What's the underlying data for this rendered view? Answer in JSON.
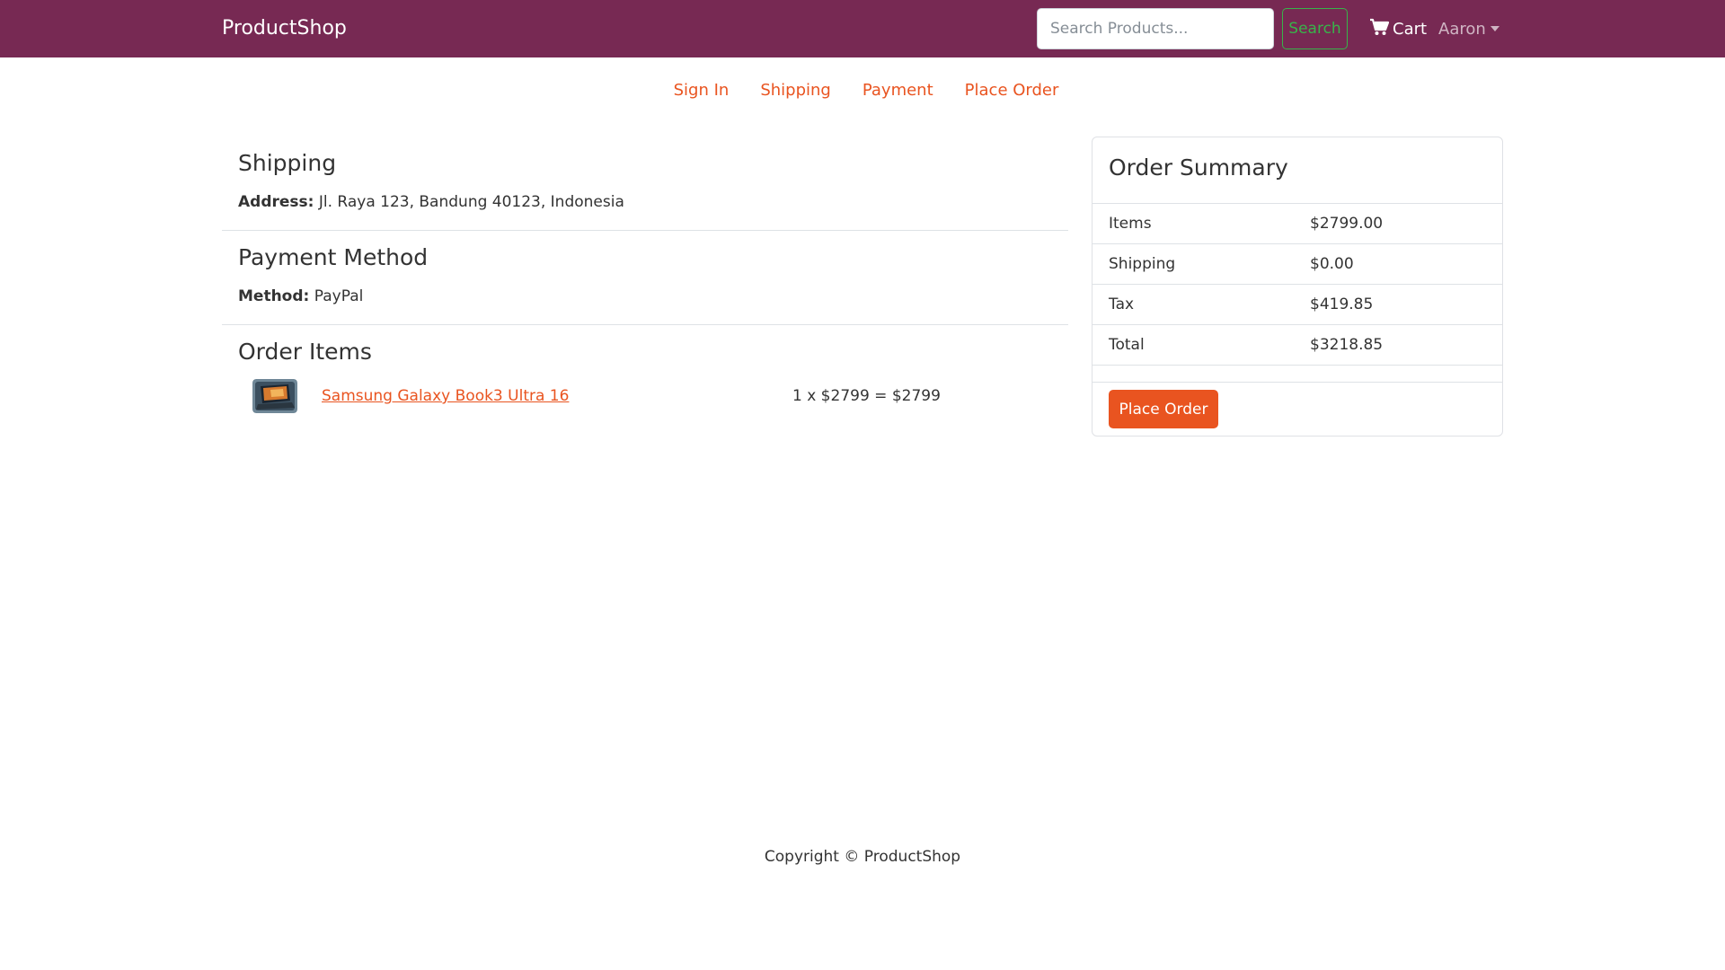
{
  "header": {
    "brand": "ProductShop",
    "search_placeholder": "Search Products...",
    "search_label": "Search",
    "cart_label": "Cart",
    "user_label": "Aaron"
  },
  "steps": {
    "sign_in": "Sign In",
    "shipping": "Shipping",
    "payment": "Payment",
    "place_order": "Place Order"
  },
  "shipping": {
    "title": "Shipping",
    "address_label": "Address:",
    "address_value": "Jl. Raya 123, Bandung 40123, Indonesia"
  },
  "payment": {
    "title": "Payment Method",
    "method_label": "Method:",
    "method_value": "PayPal"
  },
  "order_items": {
    "title": "Order Items",
    "items": [
      {
        "name": "Samsung Galaxy Book3 Ultra 16",
        "calc": "1 x $2799 = $2799"
      }
    ]
  },
  "summary": {
    "title": "Order Summary",
    "rows": [
      {
        "label": "Items",
        "value": "$2799.00"
      },
      {
        "label": "Shipping",
        "value": "$0.00"
      },
      {
        "label": "Tax",
        "value": "$419.85"
      },
      {
        "label": "Total",
        "value": "$3218.85"
      }
    ],
    "button_label": "Place Order"
  },
  "footer": {
    "text": "Copyright © ProductShop"
  },
  "colors": {
    "navbar": "#772953",
    "accent": "#e95420",
    "success": "#38b44a"
  }
}
